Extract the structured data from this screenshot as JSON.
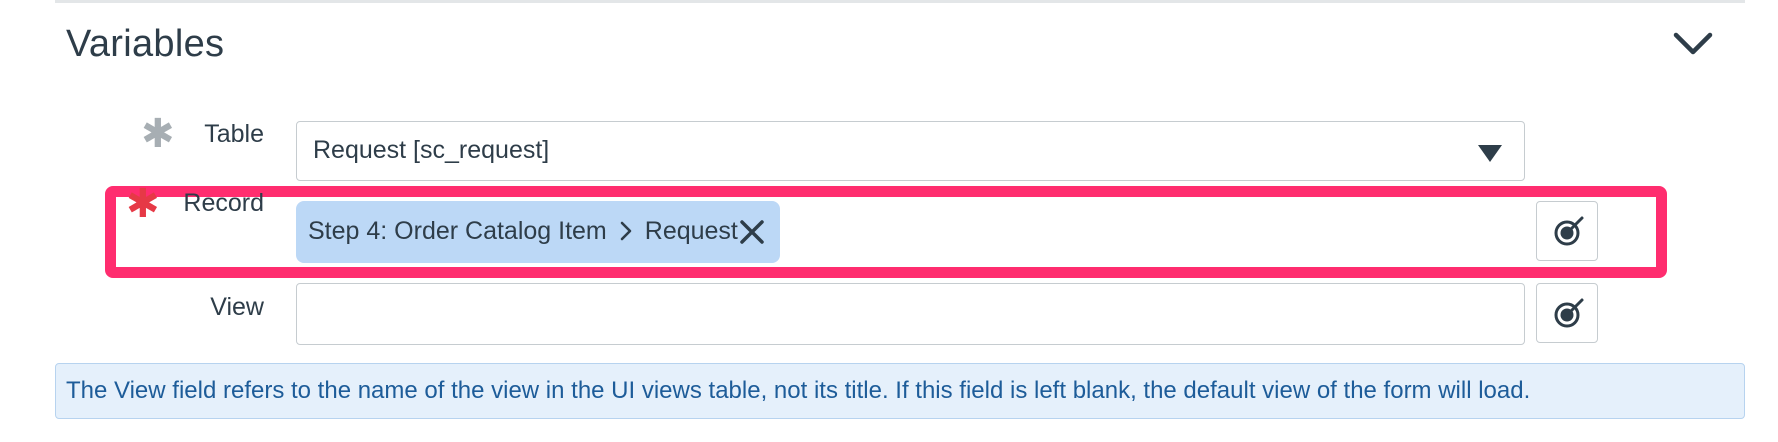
{
  "section": {
    "title": "Variables",
    "collapse_icon": "chevron-down-icon"
  },
  "fields": {
    "table": {
      "label": "Table",
      "required_marker": "✱",
      "required_state": "inactive",
      "value": "Request [sc_request]",
      "dropdown_icon": "caret-down-icon"
    },
    "record": {
      "label": "Record",
      "required_marker": "✱",
      "required_state": "active",
      "pill": {
        "step": "Step 4: Order Catalog Item",
        "separator_icon": "chevron-right-icon",
        "target": "Request",
        "remove_icon": "close-icon"
      },
      "picker_icon": "data-pill-picker-icon",
      "highlight_color": "#ff2d6f"
    },
    "view": {
      "label": "View",
      "value": "",
      "picker_icon": "data-pill-picker-icon"
    }
  },
  "info": {
    "text": "The View field refers to the name of the view in the UI views table, not its title. If this field is left blank, the default view of the form will load."
  },
  "colors": {
    "required_active": "#e63946",
    "required_inactive": "#a7aeb3",
    "pill_bg": "#bcd8f6",
    "info_bg": "#e5f0fb",
    "info_text": "#1d5c99"
  }
}
